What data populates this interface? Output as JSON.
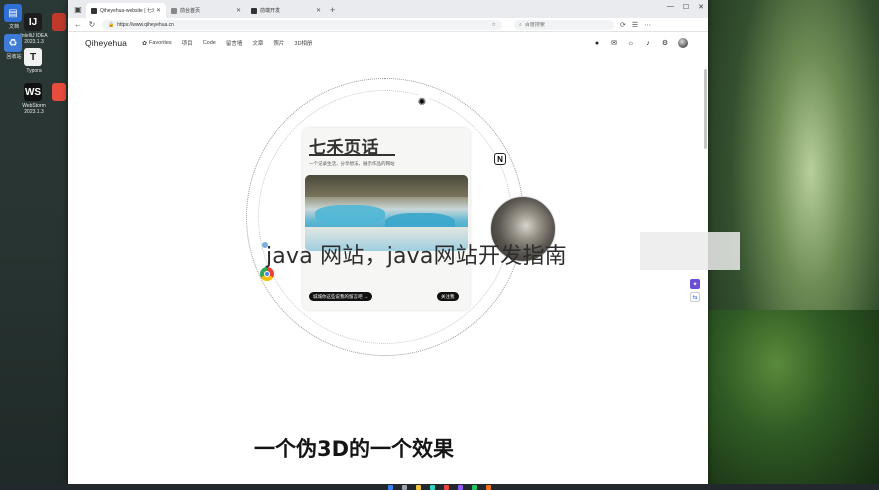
{
  "desktop": {
    "left_icons": [
      {
        "label": "文档",
        "color": "#2f6fd6",
        "glyph": "▤"
      },
      {
        "label": "IntelliJ IDEA 2023.1.3",
        "color": "#1d1d1d",
        "glyph": "IJ"
      },
      {
        "label": "回收站",
        "color": "#3d7bd6",
        "glyph": "♻"
      },
      {
        "label": "Typora",
        "color": "#f2f2f2",
        "glyph": "T"
      },
      {
        "label": "WebStorm 2023.1.3",
        "color": "#111111",
        "glyph": "WS"
      }
    ]
  },
  "browser": {
    "tabs": [
      {
        "title": "Qiheyehua-website | 七禾页话",
        "active": true
      },
      {
        "title": "前台首页",
        "active": false
      },
      {
        "title": "前端开发",
        "active": false
      }
    ],
    "url": "https://www.qiheyehua.cn",
    "search_placeholder": "百度搜索",
    "win_min": "—",
    "win_max": "☐",
    "win_close": "✕",
    "new_tab": "+",
    "nav_back": "←",
    "nav_forward": "→",
    "nav_reload": "↻",
    "toolbar_icons": [
      "☆",
      "⟳",
      "☰",
      "⋯"
    ]
  },
  "site": {
    "logo": "Qiheyehua",
    "nav": [
      {
        "label": "Favorites",
        "icon": "✿"
      },
      {
        "label": "项目"
      },
      {
        "label": "Code"
      },
      {
        "label": "留言墙"
      },
      {
        "label": "文章"
      },
      {
        "label": "照片"
      },
      {
        "label": "3D相册"
      }
    ],
    "header_icons": [
      "GitHub",
      "mail",
      "sun",
      "TikTok",
      "gear"
    ],
    "card": {
      "title": "七禾页话",
      "subtitle": "一个记录生活，分享想法，展示作品的网站",
      "btn_left": "城城你这些说我的留言吧 →",
      "btn_right": "关注我"
    },
    "overlay_text": "java 网站，java网站开发指南",
    "heading": "一个伪3D的一个效果"
  }
}
